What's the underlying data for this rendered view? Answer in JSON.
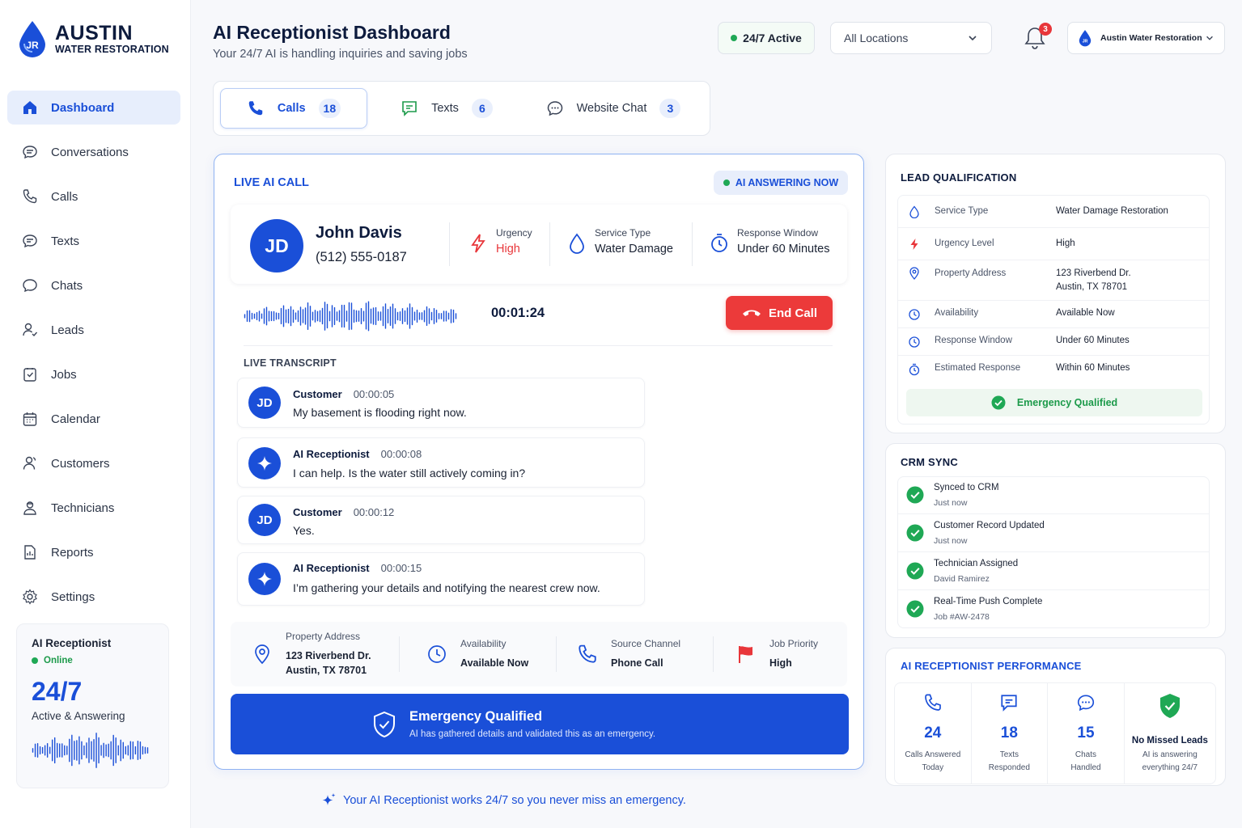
{
  "brand": {
    "name": "AUSTIN",
    "sub": "WATER RESTORATION",
    "logo_initials": "JR"
  },
  "nav": [
    {
      "label": "Dashboard",
      "icon": "home-icon",
      "active": true
    },
    {
      "label": "Conversations",
      "icon": "chat-bubble-icon"
    },
    {
      "label": "Calls",
      "icon": "phone-icon"
    },
    {
      "label": "Texts",
      "icon": "message-icon"
    },
    {
      "label": "Chats",
      "icon": "chat-icon"
    },
    {
      "label": "Leads",
      "icon": "leads-icon"
    },
    {
      "label": "Jobs",
      "icon": "clipboard-icon"
    },
    {
      "label": "Calendar",
      "icon": "calendar-icon"
    },
    {
      "label": "Customers",
      "icon": "customers-icon"
    },
    {
      "label": "Technicians",
      "icon": "technician-icon"
    },
    {
      "label": "Reports",
      "icon": "report-icon"
    },
    {
      "label": "Settings",
      "icon": "gear-icon"
    }
  ],
  "ai_card": {
    "title": "AI Receptionist",
    "status": "Online",
    "big": "24/7",
    "sub": "Active & Answering"
  },
  "header": {
    "title": "AI Receptionist Dashboard",
    "subtitle": "Your 24/7 AI is handling inquiries and saving jobs",
    "active_label": "24/7 Active",
    "location": "All Locations",
    "notifications": "3",
    "account": "Austin Water Restoration",
    "account_initials": "JR"
  },
  "tabs": [
    {
      "label": "Calls",
      "count": "18",
      "icon": "phone-icon",
      "active": true
    },
    {
      "label": "Texts",
      "count": "6",
      "icon": "message-icon"
    },
    {
      "label": "Website Chat",
      "count": "3",
      "icon": "chat-icon"
    }
  ],
  "live": {
    "title": "LIVE AI CALL",
    "answering": "AI ANSWERING NOW",
    "caller": {
      "initials": "JD",
      "name": "John Davis",
      "phone": "(512) 555-0187"
    },
    "urgency": {
      "label": "Urgency",
      "value": "High"
    },
    "service": {
      "label": "Service Type",
      "value": "Water Damage"
    },
    "window": {
      "label": "Response Window",
      "value": "Under 60 Minutes"
    },
    "timer": "00:01:24",
    "end_call": "End Call",
    "transcript_title": "LIVE TRANSCRIPT",
    "messages": [
      {
        "who": "Customer",
        "time": "00:00:05",
        "text": "My basement is flooding right now.",
        "avatar": "JD",
        "ai": false
      },
      {
        "who": "AI Receptionist",
        "time": "00:00:08",
        "text": "I can help. Is the water still actively coming in?",
        "avatar": "",
        "ai": true
      },
      {
        "who": "Customer",
        "time": "00:00:12",
        "text": "Yes.",
        "avatar": "JD",
        "ai": false
      },
      {
        "who": "AI Receptionist",
        "time": "00:00:15",
        "text": "I’m gathering your details and notifying the nearest crew now.",
        "avatar": "",
        "ai": true
      }
    ],
    "details": [
      {
        "label": "Property Address",
        "value": "123 Riverbend Dr.",
        "value2": "Austin, TX 78701"
      },
      {
        "label": "Availability",
        "value": "Available Now"
      },
      {
        "label": "Source Channel",
        "value": "Phone Call"
      },
      {
        "label": "Job Priority",
        "value": "High"
      }
    ],
    "banner_title": "Emergency Qualified",
    "banner_sub": "AI has gathered details and validated this as an emergency."
  },
  "footer_note": "Your AI Receptionist works 24/7 so you never miss an emergency.",
  "lead": {
    "title": "LEAD QUALIFICATION",
    "rows": [
      {
        "label": "Service Type",
        "value": "Water Damage Restoration",
        "icon": "droplet-icon"
      },
      {
        "label": "Urgency Level",
        "value": "High",
        "icon": "lightning-icon"
      },
      {
        "label": "Property Address",
        "value": "123 Riverbend Dr.",
        "value2": "Austin, TX 78701",
        "icon": "pin-icon"
      },
      {
        "label": "Availability",
        "value": "Available Now",
        "icon": "clock-icon"
      },
      {
        "label": "Response Window",
        "value": "Under 60 Minutes",
        "icon": "clock-icon"
      },
      {
        "label": "Estimated Response",
        "value": "Within 60 Minutes",
        "icon": "timer-icon"
      }
    ],
    "qualified": "Emergency Qualified"
  },
  "crm": {
    "title": "CRM SYNC",
    "rows": [
      {
        "title": "Synced to CRM",
        "sub": "Just now"
      },
      {
        "title": "Customer Record Updated",
        "sub": "Just now"
      },
      {
        "title": "Technician Assigned",
        "sub": "David Ramirez"
      },
      {
        "title": "Real-Time Push Complete",
        "sub": "Job #AW-2478"
      }
    ]
  },
  "perf": {
    "title": "AI RECEPTIONIST PERFORMANCE",
    "stats": [
      {
        "value": "24",
        "label1": "Calls Answered",
        "label2": "Today"
      },
      {
        "value": "18",
        "label1": "Texts",
        "label2": "Responded"
      },
      {
        "value": "15",
        "label1": "Chats",
        "label2": "Handled"
      }
    ],
    "no_missed": "No Missed Leads",
    "no_missed_sub1": "AI is answering",
    "no_missed_sub2": "everything 24/7"
  },
  "colors": {
    "accent": "#1a4fd8",
    "danger": "#ec3a3a",
    "success": "#1fa855"
  }
}
